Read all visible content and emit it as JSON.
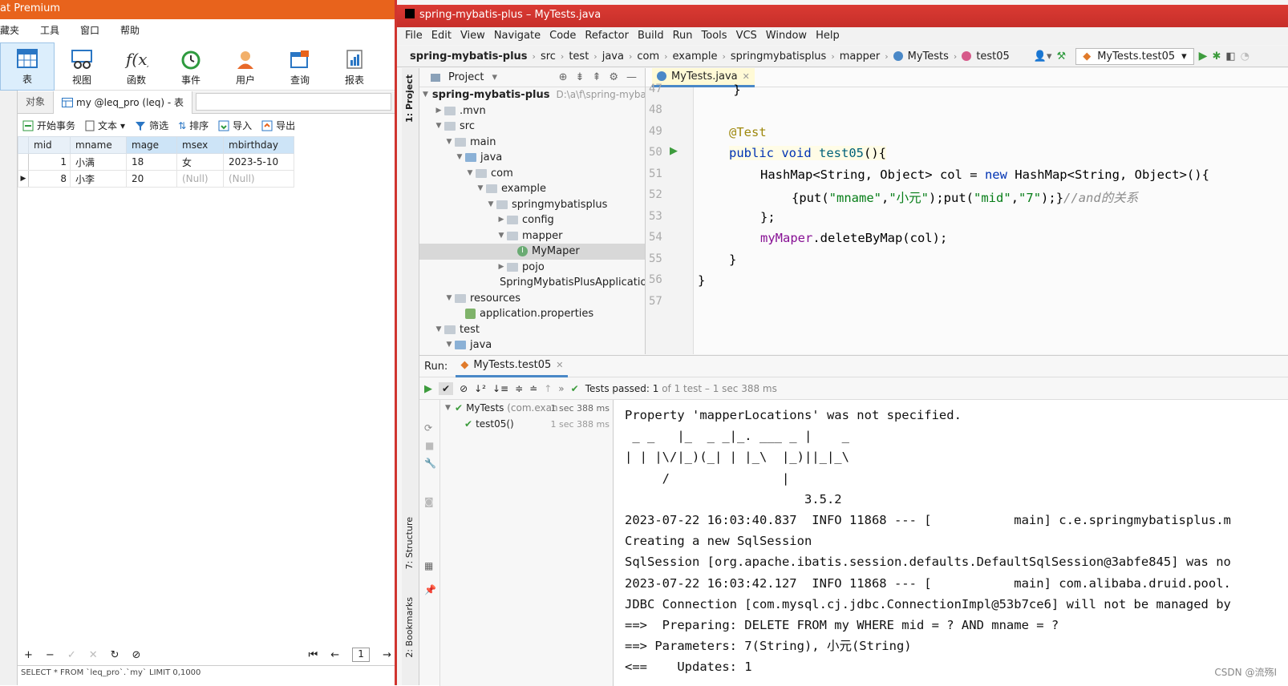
{
  "navicat": {
    "title": "at Premium",
    "menu": [
      "藏夹",
      "工具",
      "窗口",
      "帮助"
    ],
    "toolbar": [
      {
        "label": "表",
        "icon": "table-icon",
        "active": true
      },
      {
        "label": "视图",
        "icon": "view-icon"
      },
      {
        "label": "函数",
        "icon": "function-icon"
      },
      {
        "label": "事件",
        "icon": "clock-icon"
      },
      {
        "label": "用户",
        "icon": "user-icon"
      },
      {
        "label": "查询",
        "icon": "query-icon"
      },
      {
        "label": "报表",
        "icon": "report-icon"
      }
    ],
    "tabs": {
      "objects": "对象",
      "table": "my @leq_pro (leq) - 表"
    },
    "actions": [
      "开始事务",
      "文本",
      "筛选",
      "排序",
      "导入",
      "导出"
    ],
    "columns": [
      "mid",
      "mname",
      "mage",
      "msex",
      "mbirthday"
    ],
    "rows": [
      {
        "mid": "1",
        "mname": "小满",
        "mage": "18",
        "msex": "女",
        "mbirthday": "2023-5-10"
      },
      {
        "mid": "8",
        "mname": "小李",
        "mage": "20",
        "msex": "(Null)",
        "mbirthday": "(Null)"
      }
    ],
    "page": "1",
    "status": "SELECT * FROM `leq_pro`.`my` LIMIT 0,1000"
  },
  "idea": {
    "title": "spring-mybatis-plus – MyTests.java",
    "menu": [
      "File",
      "Edit",
      "View",
      "Navigate",
      "Code",
      "Refactor",
      "Build",
      "Run",
      "Tools",
      "VCS",
      "Window",
      "Help"
    ],
    "breadcrumbs": [
      "spring-mybatis-plus",
      "src",
      "test",
      "java",
      "com",
      "example",
      "springmybatisplus",
      "mapper",
      "MyTests",
      "test05"
    ],
    "run_config": "MyTests.test05",
    "stripe": {
      "project": "1: Project",
      "structure": "7: Structure",
      "bookmarks": "2: Bookmarks"
    },
    "project_header": "Project",
    "project_path": "D:\\a\\f\\spring-myba",
    "tree": [
      {
        "label": "spring-mybatis-plus",
        "level": 0,
        "bold": true,
        "arrow": "v"
      },
      {
        "label": ".mvn",
        "level": 1,
        "arrow": ">"
      },
      {
        "label": "src",
        "level": 1,
        "arrow": "v"
      },
      {
        "label": "main",
        "level": 2,
        "arrow": "v"
      },
      {
        "label": "java",
        "level": 3,
        "arrow": "v",
        "kind": "src"
      },
      {
        "label": "com",
        "level": 4,
        "arrow": "v"
      },
      {
        "label": "example",
        "level": 5,
        "arrow": "v"
      },
      {
        "label": "springmybatisplus",
        "level": 6,
        "arrow": "v"
      },
      {
        "label": "config",
        "level": 7,
        "arrow": ">"
      },
      {
        "label": "mapper",
        "level": 7,
        "arrow": "v"
      },
      {
        "label": "MyMaper",
        "level": 8,
        "arrow": "",
        "kind": "interface",
        "selected": true
      },
      {
        "label": "pojo",
        "level": 7,
        "arrow": ">"
      },
      {
        "label": "SpringMybatisPlusApplication",
        "level": 7,
        "arrow": "",
        "kind": "class"
      },
      {
        "label": "resources",
        "level": 2,
        "arrow": "v"
      },
      {
        "label": "application.properties",
        "level": 3,
        "arrow": "",
        "kind": "props"
      },
      {
        "label": "test",
        "level": 1,
        "arrow": "v"
      },
      {
        "label": "java",
        "level": 2,
        "arrow": "v",
        "kind": "src"
      }
    ],
    "editor_tab": "MyTests.java",
    "line_numbers": [
      "47",
      "48",
      "49",
      "50",
      "51",
      "52",
      "53",
      "54",
      "55",
      "56",
      "57"
    ],
    "code": {
      "l47": "    }",
      "l49_anno": "@Test",
      "l50_kw1": "public",
      "l50_kw2": "void",
      "l50_fn": "test05",
      "l50_rest": "(){",
      "l51_a": "HashMap<String, Object> col = ",
      "l51_kw": "new",
      "l51_b": " HashMap<String, Object>(){",
      "l52_a": "{put(",
      "l52_s1": "\"mname\"",
      "l52_b": ",",
      "l52_s2": "\"小元\"",
      "l52_c": ");put(",
      "l52_s3": "\"mid\"",
      "l52_d": ",",
      "l52_s4": "\"7\"",
      "l52_e": ");}",
      "l52_cm": "//and的关系",
      "l53": "};",
      "l54_fld": "myMaper",
      "l54_rest": ".deleteByMap(col);",
      "l55": "}",
      "l56": "}"
    },
    "run_label": "Run:",
    "run_tab": "MyTests.test05",
    "tests_passed": "Tests passed: 1",
    "tests_detail": "of 1 test – 1 sec 388 ms",
    "run_tree": [
      {
        "label": "MyTests",
        "sub": "(com.exan",
        "time": "1 sec 388 ms"
      },
      {
        "label": "test05()",
        "time": "1 sec 388 ms"
      }
    ],
    "console": [
      "Property 'mapperLocations' was not specified.",
      " _ _   |_  _ _|_. ___ _ |    _",
      "| | |\\/|_)(_| | |_\\  |_)||_|_\\",
      "     /               |",
      "                        3.5.2",
      "2023-07-22 16:03:40.837  INFO 11868 --- [           main] c.e.springmybatisplus.m",
      "Creating a new SqlSession",
      "SqlSession [org.apache.ibatis.session.defaults.DefaultSqlSession@3abfe845] was no",
      "2023-07-22 16:03:42.127  INFO 11868 --- [           main] com.alibaba.druid.pool.",
      "JDBC Connection [com.mysql.cj.jdbc.ConnectionImpl@53b7ce6] will not be managed by",
      "==>  Preparing: DELETE FROM my WHERE mid = ? AND mname = ?",
      "==> Parameters: 7(String), 小元(String)",
      "<==    Updates: 1"
    ],
    "watermark": "CSDN @流殇I"
  },
  "colors": {
    "navicat_accent": "#e8631c",
    "idea_title": "#d0352f",
    "pass_green": "#3d9c3d"
  }
}
